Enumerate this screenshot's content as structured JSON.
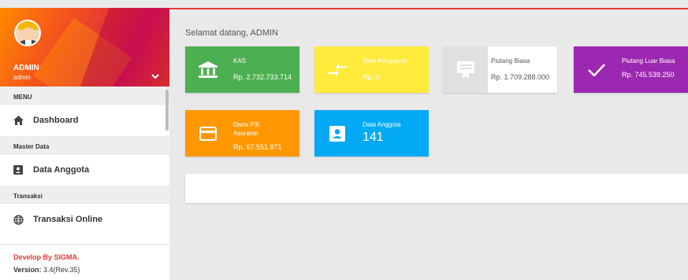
{
  "user": {
    "name": "ADMIN",
    "role": "admin"
  },
  "menu": {
    "header": "MENU",
    "dashboard": "Dashboard",
    "master_data_header": "Master Data",
    "data_anggota": "Data Anggota",
    "transaksi_header": "Transaksi",
    "transaksi_online": "Transaksi Online"
  },
  "footer": {
    "developer": "Develop By SIGMA.",
    "version_label": "Version:",
    "version_value": "3.4(Rev.35)"
  },
  "welcome": "Selamat datang, ADMIN",
  "cards": [
    {
      "label": "KAS",
      "value": "Rp. 2.732.733.714",
      "color": "#4caf50",
      "icon": "bank-icon"
    },
    {
      "label": "Total Pengajuan",
      "value": "Rp. 0",
      "color": "#ffeb3b",
      "icon": "compare-arrows-icon"
    },
    {
      "label": "Piutang Biasa",
      "value": "Rp. 1.709.288.000",
      "color": "#e0e0e0",
      "icon": "card-membership-icon"
    },
    {
      "label": "Piutang Luar Biasa",
      "value": "Rp. 745.539.250",
      "color": "#9c27b0",
      "icon": "check-icon"
    },
    {
      "label": "Dana P3/ Asuransi",
      "value": "Rp. 67.551.971",
      "color": "#ff9800",
      "icon": "credit-card-icon"
    },
    {
      "label": "Data Anggota",
      "value": "141",
      "color": "#03a9f4",
      "icon": "account-box-icon"
    }
  ]
}
